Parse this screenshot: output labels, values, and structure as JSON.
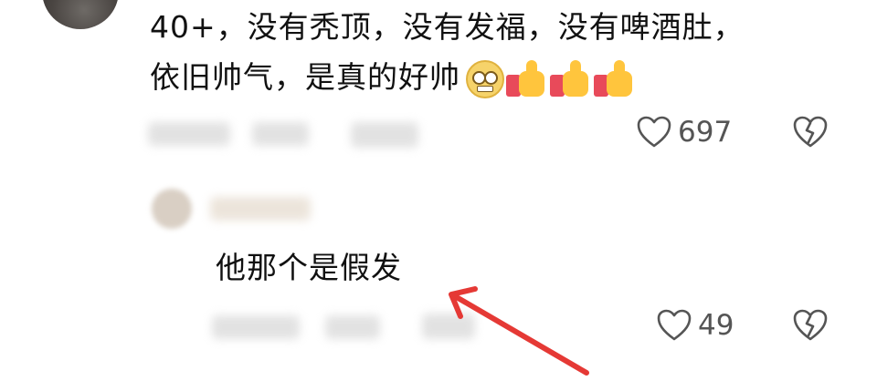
{
  "comments": [
    {
      "text_line1": "40+，没有秃顶，没有发福，没有啤酒肚，",
      "text_line2": "依旧帅气，是真的好帅",
      "emojis": [
        "grinning-face-icon",
        "thumbs-up-icon",
        "thumbs-up-icon",
        "thumbs-up-icon"
      ],
      "like_count": "697",
      "like_icon": "heart-outline-icon",
      "dislike_icon": "broken-heart-icon"
    }
  ],
  "reply": {
    "text": "他那个是假发",
    "like_count": "49",
    "like_icon": "heart-outline-icon",
    "dislike_icon": "broken-heart-icon"
  },
  "annotation": {
    "arrow_color": "#e53935"
  }
}
